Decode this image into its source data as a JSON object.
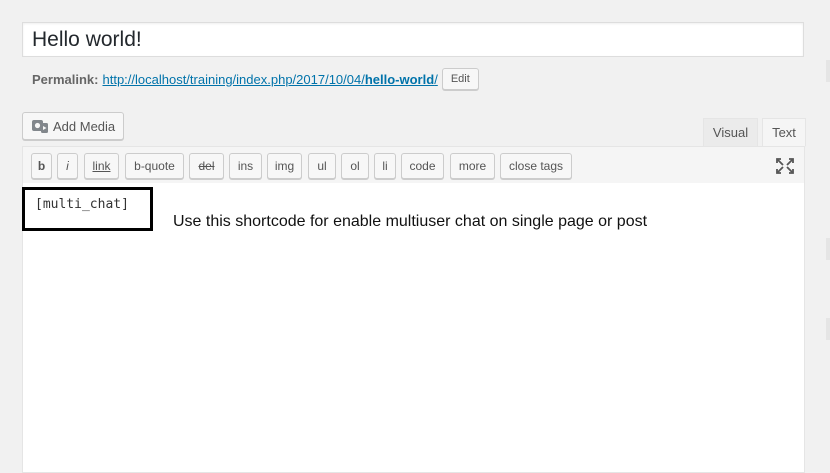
{
  "post": {
    "title": "Hello world!"
  },
  "permalink": {
    "label": "Permalink:",
    "url_prefix": "http://localhost/training/index.php/2017/10/04/",
    "slug": "hello-world",
    "url_suffix": "/",
    "edit_label": "Edit"
  },
  "media": {
    "add_label": "Add Media",
    "icon": "media-camera-icon"
  },
  "tabs": {
    "visual": "Visual",
    "text": "Text",
    "active": "Text"
  },
  "quicktags": {
    "buttons": [
      "b",
      "i",
      "link",
      "b-quote",
      "del",
      "ins",
      "img",
      "ul",
      "ol",
      "li",
      "code",
      "more",
      "close tags"
    ],
    "fullscreen_icon": "fullscreen-expand-icon"
  },
  "editor": {
    "content": "[multi_chat]"
  },
  "annotation": {
    "text": "Use this shortcode for enable multiuser chat on single page or post"
  }
}
